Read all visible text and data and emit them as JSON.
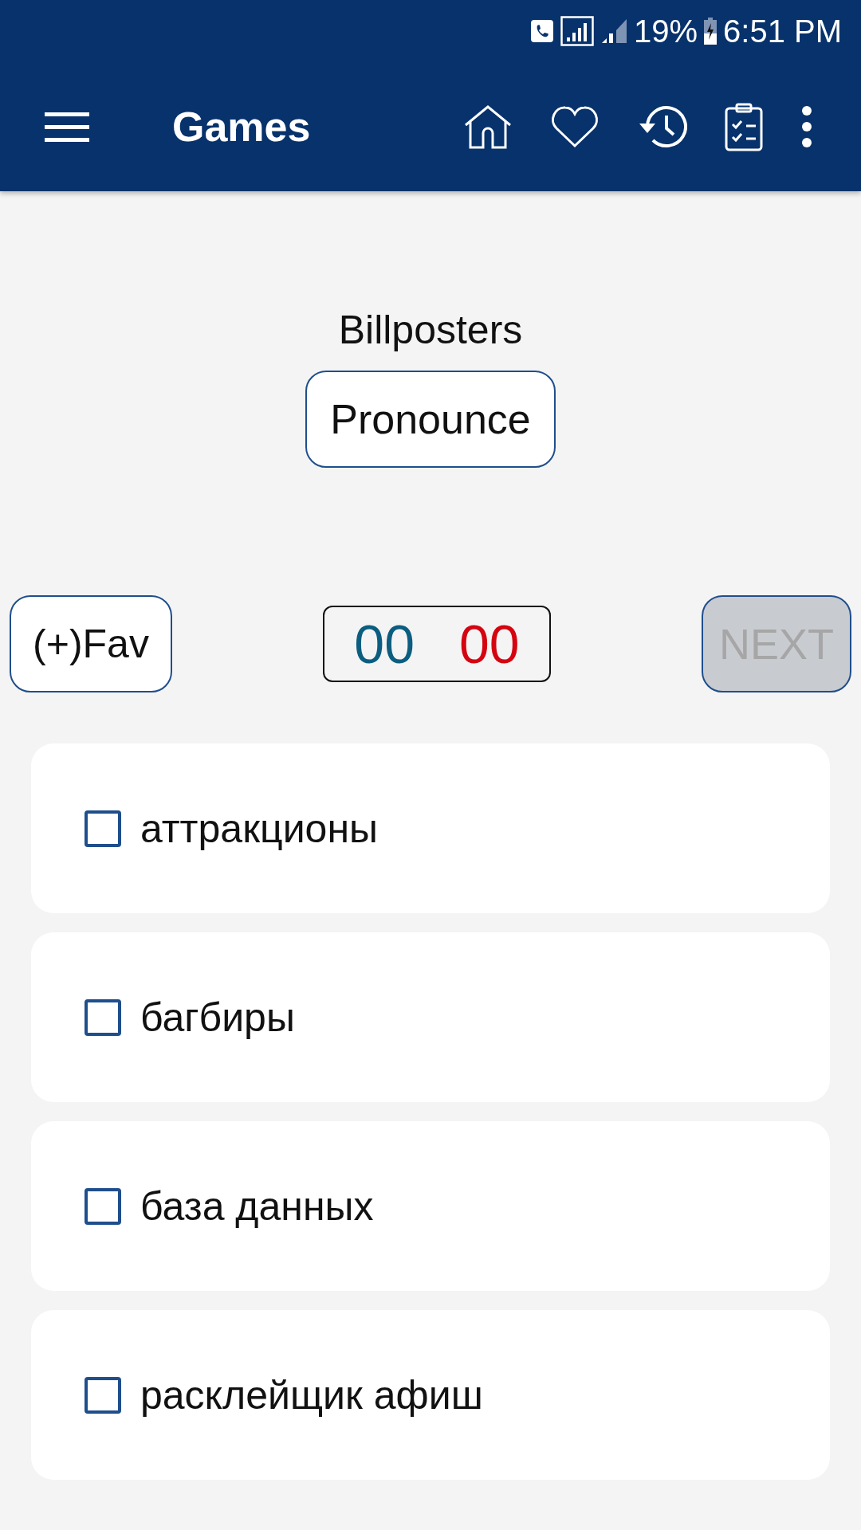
{
  "status_bar": {
    "battery": "19%",
    "time": "6:51 PM"
  },
  "app_bar": {
    "title": "Games"
  },
  "word": "Billposters",
  "pronounce_button": "Pronounce",
  "fav_button": "(+)Fav",
  "score": [
    {
      "kind": "correct",
      "value": "00"
    },
    {
      "kind": "wrong",
      "value": "00"
    }
  ],
  "next_button": {
    "label": "NEXT",
    "disabled": true
  },
  "options": [
    {
      "label": "аттракционы",
      "checked": false
    },
    {
      "label": "багбиры",
      "checked": false
    },
    {
      "label": "база данных",
      "checked": false
    },
    {
      "label": "расклейщик афиш",
      "checked": false
    }
  ]
}
